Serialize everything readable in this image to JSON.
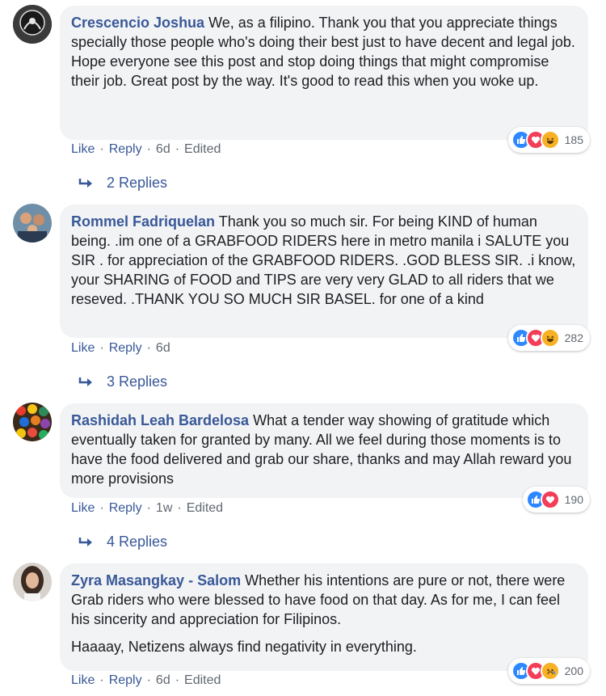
{
  "comments": [
    {
      "author": "Crescencio Joshua",
      "paragraphs": [
        "We, as a filipino. Thank you that you appreciate things specially those people who's doing their best just to have decent and legal job.",
        "Hope everyone see this post and stop doing things that might compromise their job. Great post by the way. It's good to read this when you woke up."
      ],
      "reaction_count": "185",
      "actions": {
        "like": "Like",
        "reply": "Reply",
        "time": "6d",
        "edited": "Edited"
      },
      "replies_label": "2 Replies"
    },
    {
      "author": "Rommel Fadriquelan",
      "paragraphs": [
        "Thank you so much sir. For being KIND of human being. .im one of a GRABFOOD RIDERS here in metro manila i SALUTE you SIR . for appreciation of the GRABFOOD RIDERS. .GOD BLESS SIR. .i know, your SHARING of FOOD and TIPS are very very GLAD to all riders that we reseved. .THANK YOU SO MUCH SIR BASEL. for one of a kind"
      ],
      "reaction_count": "282",
      "actions": {
        "like": "Like",
        "reply": "Reply",
        "time": "6d",
        "edited": ""
      },
      "replies_label": "3 Replies"
    },
    {
      "author": "Rashidah Leah Bardelosa",
      "paragraphs": [
        "What a tender way showing of gratitude which eventually taken for granted by many. All we feel during those moments is to have the food delivered and grab our share, thanks and may Allah reward you more provisions"
      ],
      "reaction_count": "190",
      "actions": {
        "like": "Like",
        "reply": "Reply",
        "time": "1w",
        "edited": "Edited"
      },
      "replies_label": "4 Replies"
    },
    {
      "author": "Zyra Masangkay - Salom",
      "paragraphs": [
        "Whether his intentions are pure or not, there were Grab riders who were blessed to have food on that day. As for me, I can feel his sincerity and appreciation for Filipinos.",
        "Haaaay, Netizens always find negativity in everything."
      ],
      "reaction_count": "200",
      "actions": {
        "like": "Like",
        "reply": "Reply",
        "time": "6d",
        "edited": "Edited"
      },
      "replies_label": ""
    }
  ],
  "reaction_icons": {
    "c0": [
      "like-icon",
      "love-icon",
      "haha-icon"
    ],
    "c1": [
      "like-icon",
      "love-icon",
      "haha-icon"
    ],
    "c2": [
      "like-icon",
      "love-icon"
    ],
    "c3": [
      "like-icon",
      "love-icon",
      "sad-icon"
    ]
  },
  "colors": {
    "author": "#385898",
    "bubble": "#f2f3f5",
    "like": "#2d88ff",
    "love": "#f33e58",
    "haha": "#f7b125"
  }
}
